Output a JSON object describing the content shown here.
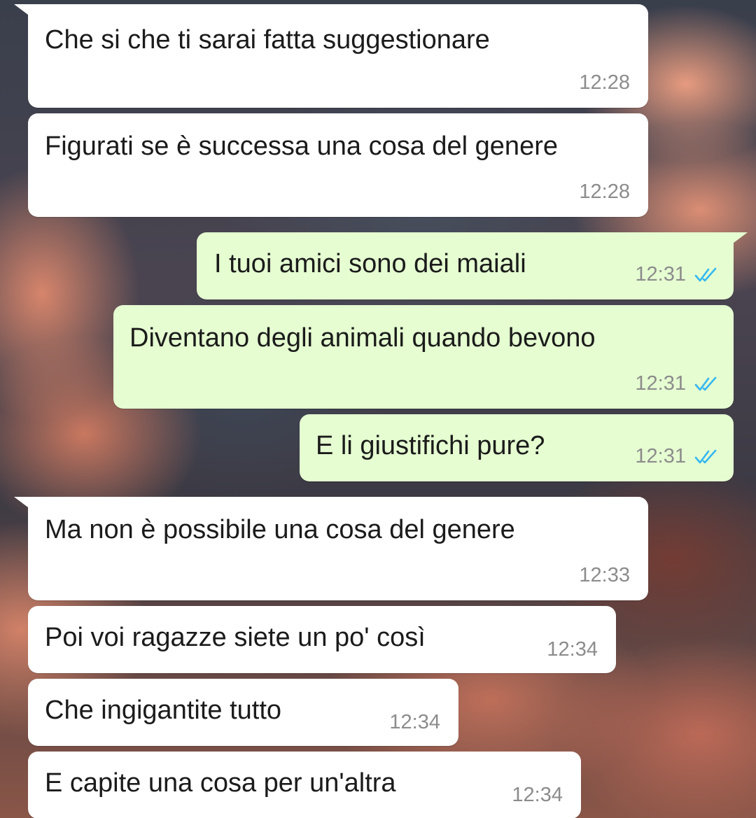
{
  "colors": {
    "incoming_bubble": "#ffffff",
    "outgoing_bubble": "#e5fdd1",
    "time_text": "#8c8c8c",
    "read_ticks": "#34b7f1"
  },
  "messages": [
    {
      "direction": "incoming",
      "text": "Che si che ti sarai fatta suggestionare",
      "time": "12:28"
    },
    {
      "direction": "incoming",
      "text": "Figurati se è successa una cosa del genere",
      "time": "12:28"
    },
    {
      "direction": "outgoing",
      "text": "I tuoi amici sono dei maiali",
      "time": "12:31",
      "status_icon": "double-check-read-icon"
    },
    {
      "direction": "outgoing",
      "text": "Diventano degli animali quando bevono",
      "time": "12:31",
      "status_icon": "double-check-read-icon"
    },
    {
      "direction": "outgoing",
      "text": "E li giustifichi pure?",
      "time": "12:31",
      "status_icon": "double-check-read-icon"
    },
    {
      "direction": "incoming",
      "text": "Ma non è possibile una cosa del genere",
      "time": "12:33"
    },
    {
      "direction": "incoming",
      "text": "Poi voi ragazze siete un po' così",
      "time": "12:34"
    },
    {
      "direction": "incoming",
      "text": "Che ingigantite tutto",
      "time": "12:34"
    },
    {
      "direction": "incoming",
      "text": "E capite una cosa per un'altra",
      "time": "12:34"
    }
  ]
}
